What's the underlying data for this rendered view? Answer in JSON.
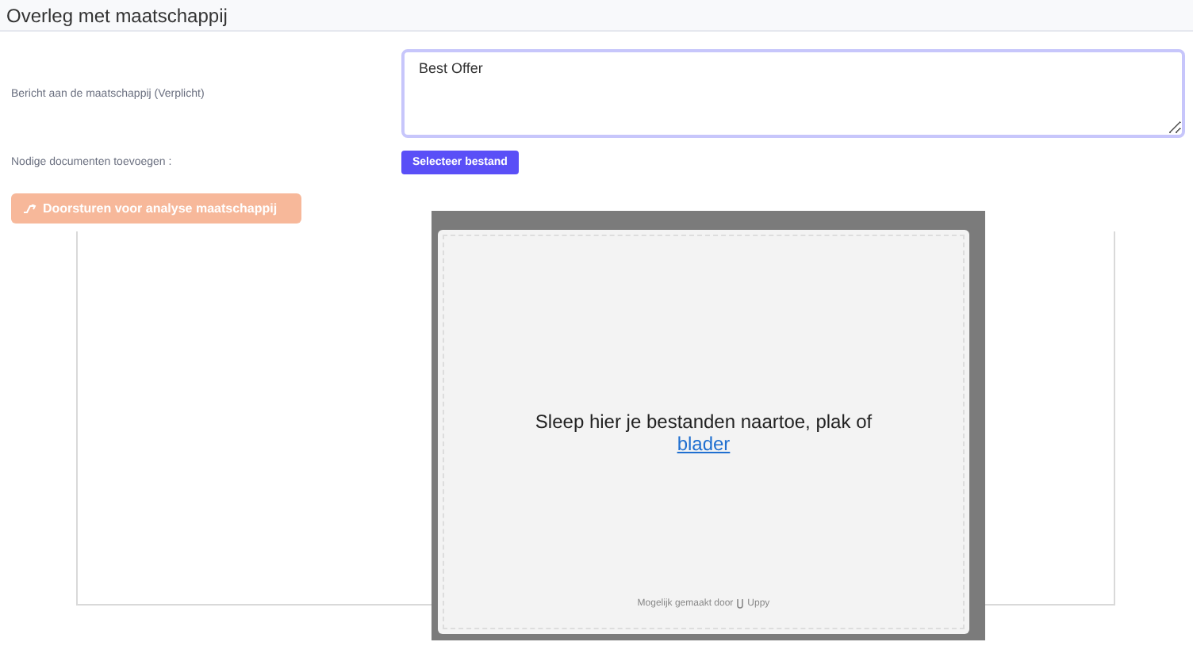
{
  "header": {
    "title": "Overleg met maatschappij"
  },
  "form": {
    "message_label": "Bericht aan de maatschappij (Verplicht)",
    "message_value": "Best Offer",
    "documents_label": "Nodige documenten toevoegen :",
    "select_button": "Selecteer bestand"
  },
  "submit_button": {
    "label": "Doorsturen voor analyse maatschappij",
    "disabled": true
  },
  "upload_dialog": {
    "drop_text": "Sleep hier je bestanden naartoe, plak of",
    "browse_link": "blader",
    "powered_by": "Mogelijk gemaakt door",
    "brand": "Uppy"
  }
}
